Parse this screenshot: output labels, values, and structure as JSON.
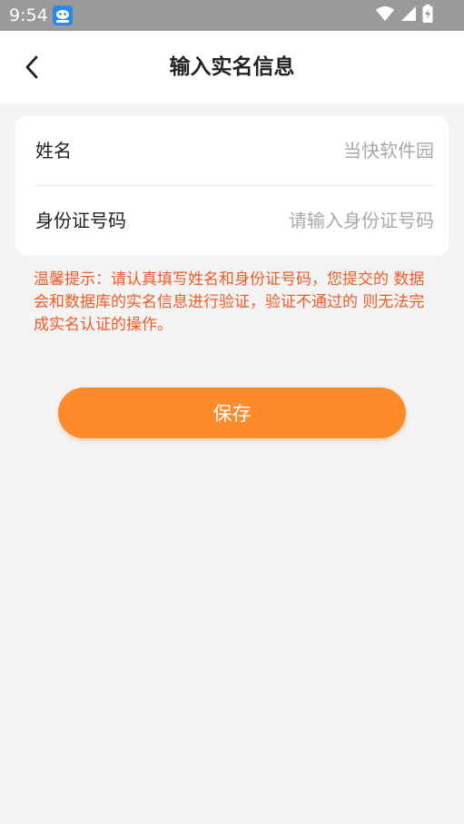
{
  "status_bar": {
    "time": "9:54",
    "app_icon": "app-icon",
    "wifi_icon": "wifi-icon",
    "signal_icon": "signal-icon",
    "battery_icon": "battery-charging-icon"
  },
  "header": {
    "title": "输入实名信息",
    "back_icon": "chevron-left-icon"
  },
  "form": {
    "name": {
      "label": "姓名",
      "placeholder": "当快软件园"
    },
    "id_number": {
      "label": "身份证号码",
      "placeholder": "请输入身份证号码"
    }
  },
  "tip": {
    "text": "温馨提示：请认真填写姓名和身份证号码，您提交的 数据会和数据库的实名信息进行验证，验证不通过的 则无法完成实名认证的操作。"
  },
  "actions": {
    "save_label": "保存"
  },
  "colors": {
    "accent": "#ff8a2a",
    "tip": "#ef5a27",
    "background": "#f4f4f4",
    "status_bar": "#9a9a9a"
  }
}
